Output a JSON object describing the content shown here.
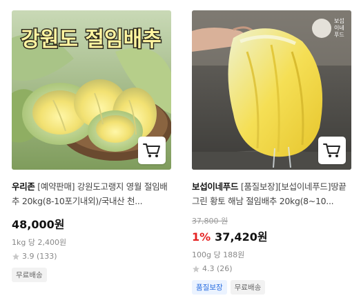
{
  "products": [
    {
      "image_caption": "강원도 절임배추",
      "brand": "우리존",
      "title": "[예약판매] 강원도고랭지 영월 절임배추 20kg(8-10포기내외)/국내산 천...",
      "price": "48,000원",
      "unit_price": "1kg 당 2,400원",
      "rating": "3.9 (133)",
      "badges": [
        "무료배송"
      ]
    },
    {
      "image_caption": "보섭이네푸드",
      "brand": "보섭이네푸드",
      "title": "[품질보장][보섭이네푸드]땅끝그린 황토 해남 절임배추 20kg(8~10...",
      "original_price": "37,800 원",
      "discount": "1%",
      "price": "37,420원",
      "unit_price": "100g 당 188원",
      "rating": "4.3 (26)",
      "badges": [
        "품질보장",
        "무료배송"
      ]
    }
  ],
  "icons": {
    "cart": "cart-icon",
    "star": "star-icon"
  },
  "colors": {
    "discount": "#e52222",
    "quality_badge_text": "#2a6ee0",
    "quality_badge_bg": "#ebf3ff"
  }
}
